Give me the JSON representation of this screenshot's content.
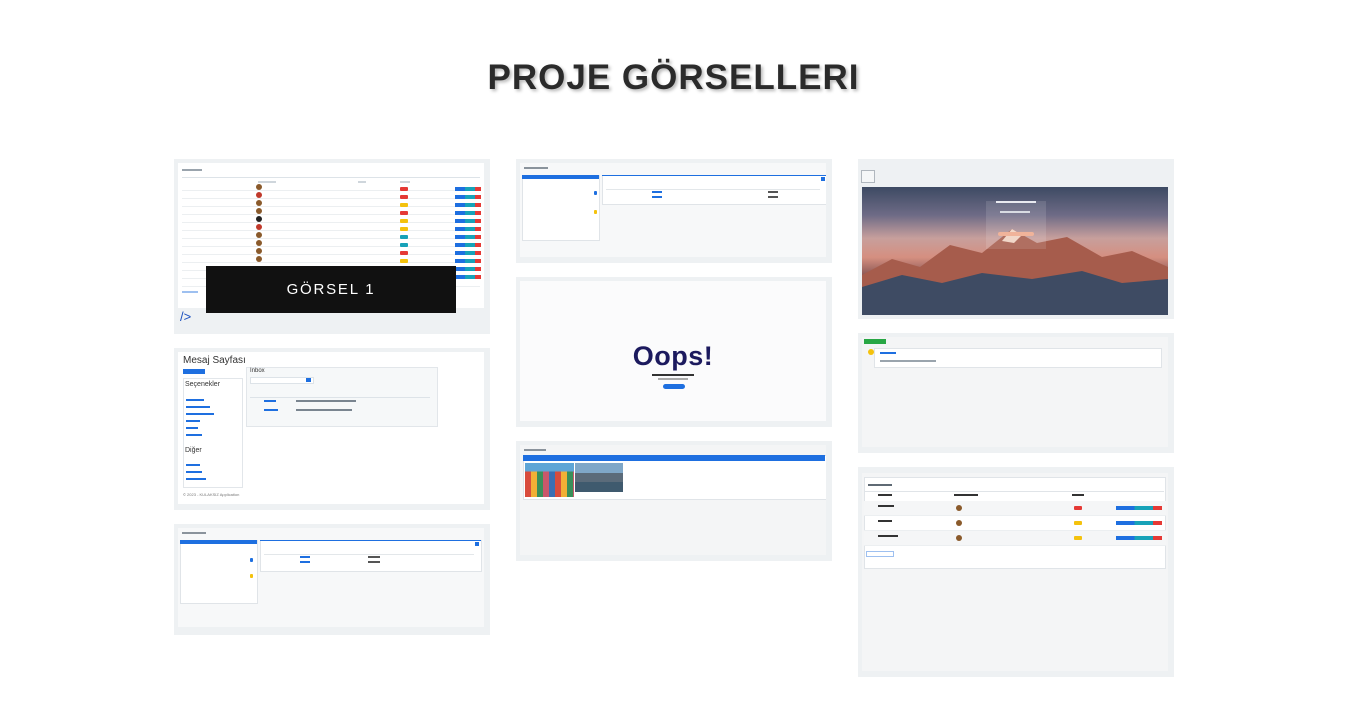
{
  "page": {
    "title": "PROJE GÖRSELLERI"
  },
  "gallery": {
    "overlay_label": "GÖRSEL 1",
    "slash_text": "/>",
    "message_page": {
      "title": "Mesaj Sayfası",
      "sidebar_heading": "Seçenekler",
      "inbox_title": "Inbox",
      "other_heading": "Diğer",
      "footer": "© 2023 - KULAKSIZ Application"
    },
    "oops": {
      "headline": "Oops!"
    }
  },
  "colors": {
    "accent": "#1e6fe0",
    "card_bg": "#eef1f3",
    "overlay": "#111111",
    "oops_text": "#1c1a5e"
  }
}
